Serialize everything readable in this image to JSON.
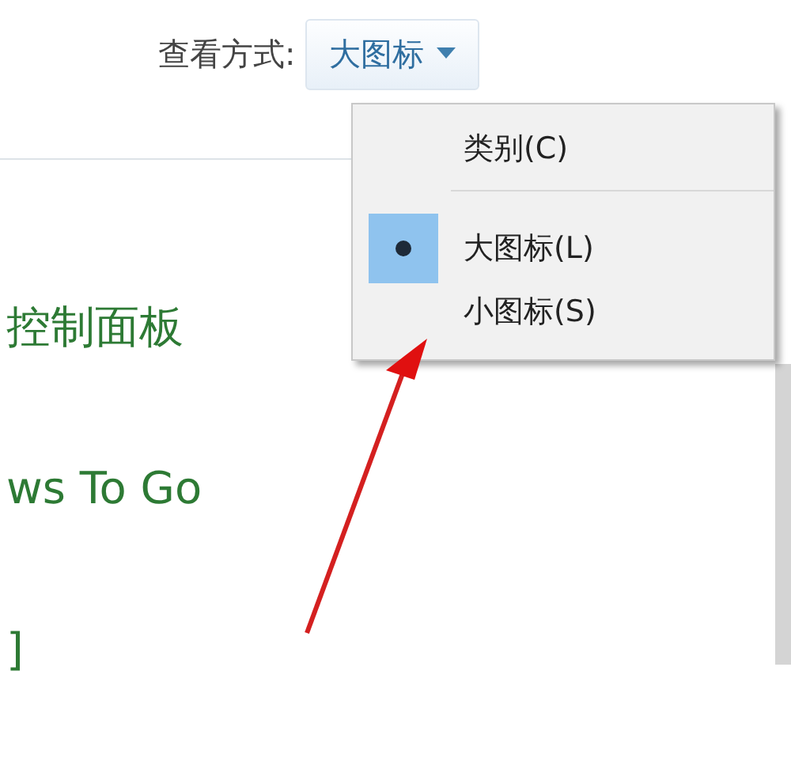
{
  "view_by": {
    "label": "查看方式:",
    "value": "大图标",
    "expanded": true
  },
  "menu": [
    {
      "label": "类别(C)",
      "selected": false
    },
    {
      "label": "大图标(L)",
      "selected": true
    },
    {
      "label": "小图标(S)",
      "selected": false
    }
  ],
  "links": [
    "控制面板",
    "ws To Go",
    "]"
  ]
}
